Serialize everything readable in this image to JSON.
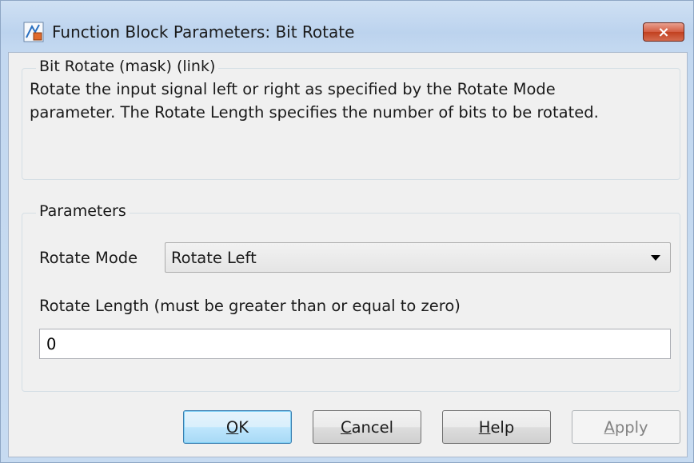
{
  "window": {
    "title": "Function Block Parameters: Bit Rotate",
    "close_label": "×"
  },
  "mask": {
    "legend": "Bit Rotate (mask) (link)",
    "description": "Rotate the input signal left or right as specified by the Rotate Mode parameter. The Rotate Length specifies the number of bits to be rotated."
  },
  "parameters": {
    "legend": "Parameters",
    "rotate_mode_label": "Rotate Mode",
    "rotate_mode_value": "Rotate Left",
    "rotate_length_label": "Rotate Length (must be greater than or equal to zero)",
    "rotate_length_value": "0"
  },
  "buttons": {
    "ok": {
      "mnemonic": "O",
      "rest": "K"
    },
    "cancel": {
      "mnemonic": "C",
      "rest": "ancel"
    },
    "help": {
      "mnemonic": "H",
      "rest": "elp"
    },
    "apply": {
      "mnemonic": "A",
      "rest": "pply"
    }
  }
}
